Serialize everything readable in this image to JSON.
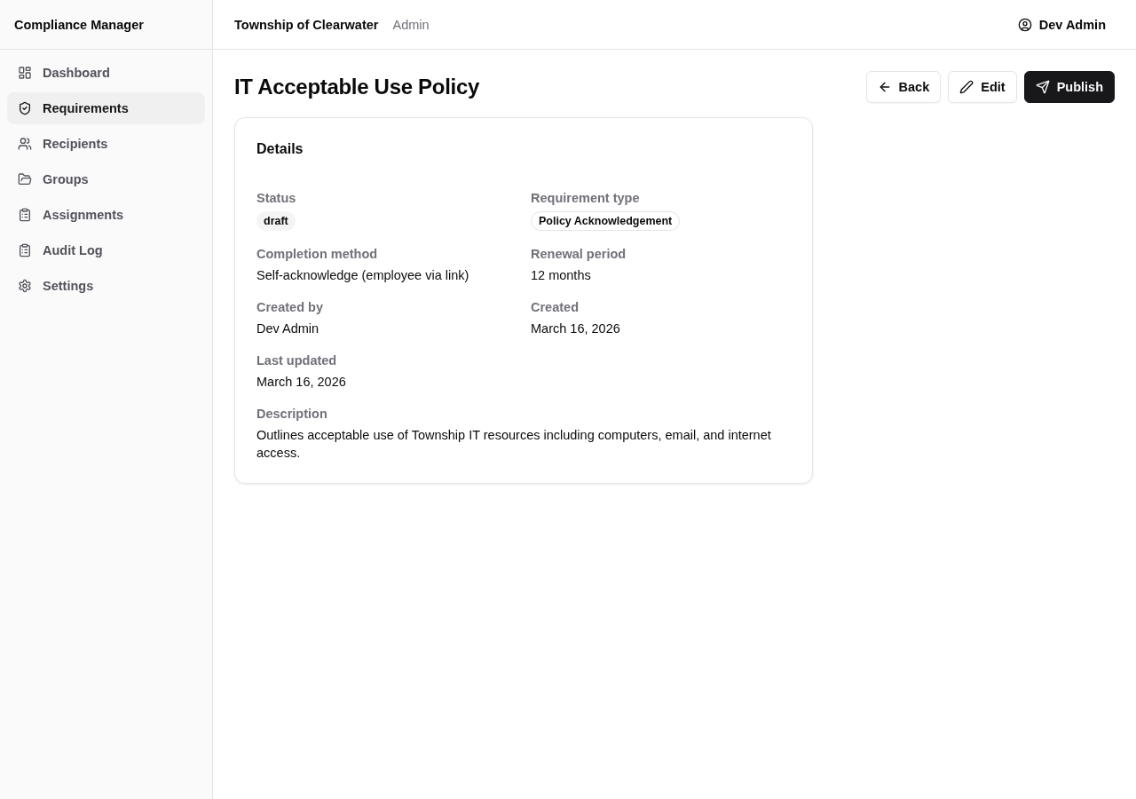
{
  "sidebar": {
    "title": "Compliance Manager",
    "items": [
      {
        "label": "Dashboard",
        "selected": false
      },
      {
        "label": "Requirements",
        "selected": true
      },
      {
        "label": "Recipients",
        "selected": false
      },
      {
        "label": "Groups",
        "selected": false
      },
      {
        "label": "Assignments",
        "selected": false
      },
      {
        "label": "Audit Log",
        "selected": false
      },
      {
        "label": "Settings",
        "selected": false
      }
    ]
  },
  "header": {
    "organization": "Township of Clearwater",
    "role": "Admin",
    "user": "Dev Admin"
  },
  "page": {
    "title": "IT Acceptable Use Policy",
    "actions": [
      {
        "label": "Back",
        "kind": "secondary"
      },
      {
        "label": "Edit",
        "kind": "secondary"
      },
      {
        "label": "Publish",
        "kind": "primary"
      }
    ]
  },
  "details": {
    "title": "Details",
    "fields": [
      {
        "label": "Status",
        "value": "draft",
        "kind": "status-badge"
      },
      {
        "label": "Requirement type",
        "value": "Policy Acknowledgement",
        "kind": "type-badge"
      },
      {
        "label": "Completion method",
        "value": "Self-acknowledge (employee via link)",
        "kind": "text"
      },
      {
        "label": "Renewal period",
        "value": "12 months",
        "kind": "text"
      },
      {
        "label": "Created by",
        "value": "Dev Admin",
        "kind": "text"
      },
      {
        "label": "Created",
        "value": "March 16, 2026",
        "kind": "text"
      },
      {
        "label": "Last updated",
        "value": "March 16, 2026",
        "kind": "text"
      },
      {
        "label": "Description",
        "value": "Outlines acceptable use of Township IT resources including computers, email, and internet access.",
        "kind": "paragraph"
      }
    ]
  }
}
